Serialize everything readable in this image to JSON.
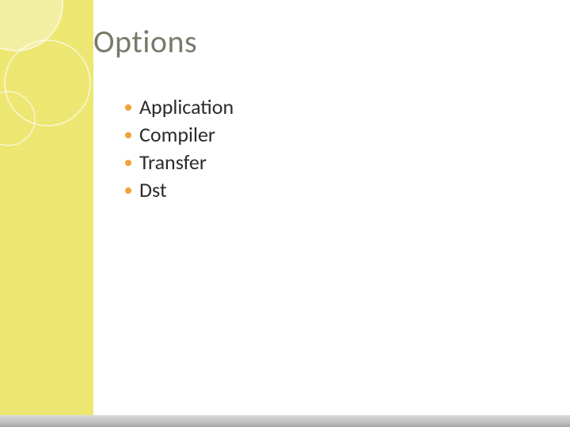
{
  "slide": {
    "title": "Options",
    "bullets": [
      "Application",
      "Compiler",
      "Transfer",
      "Dst"
    ]
  }
}
